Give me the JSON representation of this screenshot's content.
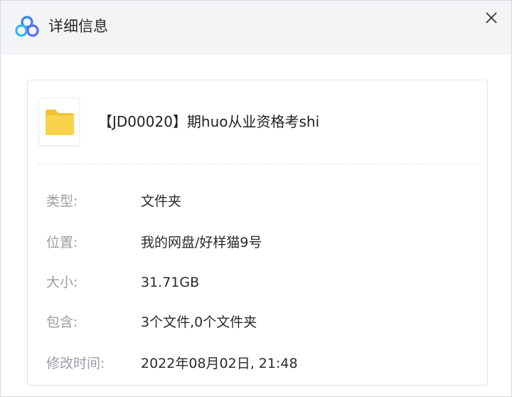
{
  "window": {
    "title": "详细信息",
    "close_symbol": "✕"
  },
  "icons": {
    "app": "baidu-netdisk-logo-icon",
    "folder": "folder-icon",
    "close": "close-icon"
  },
  "colors": {
    "logo_blue": "#3b7ff5",
    "folder_yellow": "#f9d44a",
    "label_gray": "#9a9da3",
    "value_dark": "#2a2a2a"
  },
  "file": {
    "name": "【JD00020】期huo从业资格考shi"
  },
  "details": [
    {
      "label": "类型:",
      "value": "文件夹"
    },
    {
      "label": "位置:",
      "value": "我的网盘/好样猫9号"
    },
    {
      "label": "大小:",
      "value": "31.71GB"
    },
    {
      "label": "包含:",
      "value": "3个文件,0个文件夹"
    },
    {
      "label": "修改时间:",
      "value": "2022年08月02日, 21:48"
    }
  ]
}
